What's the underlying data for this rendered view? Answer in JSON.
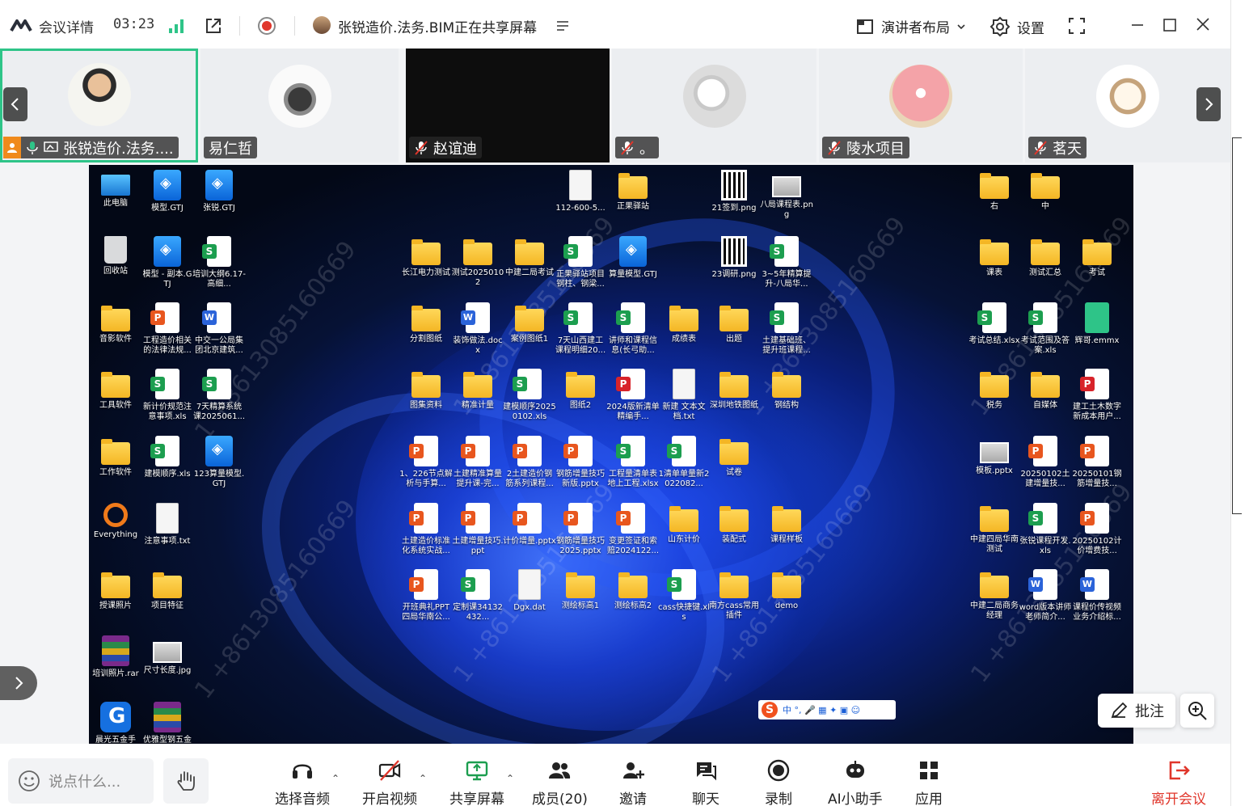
{
  "topbar": {
    "meeting_info": "会议详情",
    "timer": "03:23",
    "sharer_text": "张锐造价.法务.BIM正在共享屏幕",
    "layout_label": "演讲者布局",
    "settings_label": "设置"
  },
  "participants": [
    {
      "name": "张锐造价.法务....",
      "muted": false,
      "active": true
    },
    {
      "name": "易仁哲",
      "muted": false,
      "active": false
    },
    {
      "name": "赵谊迪",
      "muted": true,
      "active": false
    },
    {
      "name": "。",
      "muted": true,
      "active": false
    },
    {
      "name": "陵水项目",
      "muted": true,
      "active": false
    },
    {
      "name": "茗天",
      "muted": true,
      "active": false
    }
  ],
  "desktop": {
    "watermark": "1 +8613085160669",
    "ime_text": "中 °, 🎤 ▦ ✦ ▣ ☺",
    "icons": [
      {
        "label": "此电脑",
        "type": "monitor"
      },
      {
        "label": "模型.GTJ",
        "type": "gtj"
      },
      {
        "label": "张锐.GTJ",
        "type": "gtj"
      },
      {
        "label": "112-600-5...",
        "type": "txt"
      },
      {
        "label": "正果驿站",
        "type": "folder"
      },
      {
        "label": "21签到.png",
        "type": "qr"
      },
      {
        "label": "八局课程表.png",
        "type": "img"
      },
      {
        "label": "右",
        "type": "folder"
      },
      {
        "label": "中",
        "type": "folder"
      },
      {
        "label": "回收站",
        "type": "recycle"
      },
      {
        "label": "模型 - 副本.GTJ",
        "type": "gtj"
      },
      {
        "label": "培训大纲6.17-高细...",
        "type": "sheet"
      },
      {
        "label": "长江电力测试",
        "type": "folder"
      },
      {
        "label": "测试20250102",
        "type": "folder"
      },
      {
        "label": "中建二局考试",
        "type": "folder"
      },
      {
        "label": "正果驿站项目钢柱、钢梁...",
        "type": "sheet"
      },
      {
        "label": "算量模型.GTJ",
        "type": "gtj"
      },
      {
        "label": "23调研.png",
        "type": "qr"
      },
      {
        "label": "3~5年精算提升-八局华...",
        "type": "sheet"
      },
      {
        "label": "课表",
        "type": "folder"
      },
      {
        "label": "测试汇总",
        "type": "folder"
      },
      {
        "label": "考试",
        "type": "folder"
      },
      {
        "label": "音影软件",
        "type": "folder"
      },
      {
        "label": "工程造价相关的法律法规...",
        "type": "ppt"
      },
      {
        "label": "中交一公局集团北京建筑...",
        "type": "word"
      },
      {
        "label": "分割图纸",
        "type": "folder"
      },
      {
        "label": "装饰做法.docx",
        "type": "word"
      },
      {
        "label": "案例图纸1",
        "type": "folder"
      },
      {
        "label": "7天山西建工课程明细20...",
        "type": "sheet"
      },
      {
        "label": "讲师和课程信息(长弓助...",
        "type": "sheet"
      },
      {
        "label": "成绩表",
        "type": "folder"
      },
      {
        "label": "出题",
        "type": "folder"
      },
      {
        "label": "土建基础班、提升班课程...",
        "type": "sheet"
      },
      {
        "label": "考试总结.xlsx",
        "type": "sheet"
      },
      {
        "label": "考试范围及答案.xls",
        "type": "sheet"
      },
      {
        "label": "辉哥.emmx",
        "type": "emmx"
      },
      {
        "label": "工具软件",
        "type": "folder"
      },
      {
        "label": "新计价规范注意事项.xls",
        "type": "sheet"
      },
      {
        "label": "7天精算系统课2025061...",
        "type": "sheet"
      },
      {
        "label": "图集资料",
        "type": "folder"
      },
      {
        "label": "精准计量",
        "type": "folder"
      },
      {
        "label": "建模顺序20250102.xls",
        "type": "sheet"
      },
      {
        "label": "图纸2",
        "type": "folder"
      },
      {
        "label": "2024版新清单精编手...",
        "type": "pdf"
      },
      {
        "label": "新建 文本文档.txt",
        "type": "txt"
      },
      {
        "label": "深圳地铁图纸",
        "type": "folder"
      },
      {
        "label": "钢结构",
        "type": "folder"
      },
      {
        "label": "税务",
        "type": "folder"
      },
      {
        "label": "自媒体",
        "type": "folder"
      },
      {
        "label": "建工土木数字新成本用户...",
        "type": "pdf"
      },
      {
        "label": "工作软件",
        "type": "folder"
      },
      {
        "label": "建模顺序.xls",
        "type": "sheet"
      },
      {
        "label": "123算量模型.GTJ",
        "type": "gtj"
      },
      {
        "label": "1、226节点解析与手算...",
        "type": "ppt"
      },
      {
        "label": "土建精准算量提升课-完...",
        "type": "ppt"
      },
      {
        "label": "2土建造价钢筋系列课程...",
        "type": "ppt"
      },
      {
        "label": "钢筋增量技巧新版.pptx",
        "type": "ppt"
      },
      {
        "label": "工程量清单表地上工程.xlsx",
        "type": "sheet"
      },
      {
        "label": "1清单单量新2022082...",
        "type": "sheet"
      },
      {
        "label": "试卷",
        "type": "folder"
      },
      {
        "label": "模板.pptx",
        "type": "img"
      },
      {
        "label": "20250102土建增量技...",
        "type": "ppt"
      },
      {
        "label": "20250101钢筋增量技...",
        "type": "ppt"
      },
      {
        "label": "Everything",
        "type": "everything"
      },
      {
        "label": "注意事项.txt",
        "type": "txt"
      },
      {
        "label": "土建造价标准化系统实战...",
        "type": "ppt"
      },
      {
        "label": "土建增量技巧.ppt",
        "type": "ppt"
      },
      {
        "label": "计价增量.pptx",
        "type": "ppt"
      },
      {
        "label": "钢筋增量技巧2025.pptx",
        "type": "ppt"
      },
      {
        "label": "变更签证和索赔2024122...",
        "type": "ppt"
      },
      {
        "label": "山东计价",
        "type": "folder"
      },
      {
        "label": "装配式",
        "type": "folder"
      },
      {
        "label": "课程样板",
        "type": "folder"
      },
      {
        "label": "中建四局华南测试",
        "type": "folder"
      },
      {
        "label": "张锐课程开发.xls",
        "type": "sheet"
      },
      {
        "label": "20250102计价增费技...",
        "type": "ppt"
      },
      {
        "label": "授课照片",
        "type": "folder"
      },
      {
        "label": "项目特征",
        "type": "folder"
      },
      {
        "label": "开班典礼PPT四局华南公...",
        "type": "ppt"
      },
      {
        "label": "定制课34132432...",
        "type": "sheet"
      },
      {
        "label": "Dgx.dat",
        "type": "txt"
      },
      {
        "label": "测绘标高1",
        "type": "folder"
      },
      {
        "label": "测绘标高2",
        "type": "folder"
      },
      {
        "label": "cass快捷键.xls",
        "type": "sheet"
      },
      {
        "label": "南方cass常用插件",
        "type": "folder"
      },
      {
        "label": "demo",
        "type": "folder"
      },
      {
        "label": "中建二局商务经理",
        "type": "folder"
      },
      {
        "label": "word版本讲师老师简介...",
        "type": "word"
      },
      {
        "label": "课程价传视频业务介绍标...",
        "type": "word"
      },
      {
        "label": "培训照片.rar",
        "type": "rar"
      },
      {
        "label": "尺寸长度.jpg",
        "type": "img"
      },
      {
        "label": "晨光五金手",
        "type": "guanglian"
      },
      {
        "label": "优雅型钢五金",
        "type": "rar"
      }
    ]
  },
  "overlay": {
    "annotate_label": "批注"
  },
  "bottombar": {
    "chat_placeholder": "说点什么...",
    "audio_label": "选择音频",
    "video_label": "开启视频",
    "share_label": "共享屏幕",
    "members_label": "成员(20)",
    "invite_label": "邀请",
    "chat_label": "聊天",
    "record_label": "录制",
    "ai_label": "AI小助手",
    "apps_label": "应用",
    "leave_label": "离开会议"
  },
  "colors": {
    "active_border": "#2ec488",
    "leave_red": "#e0362b",
    "record_red": "#e0362b"
  }
}
